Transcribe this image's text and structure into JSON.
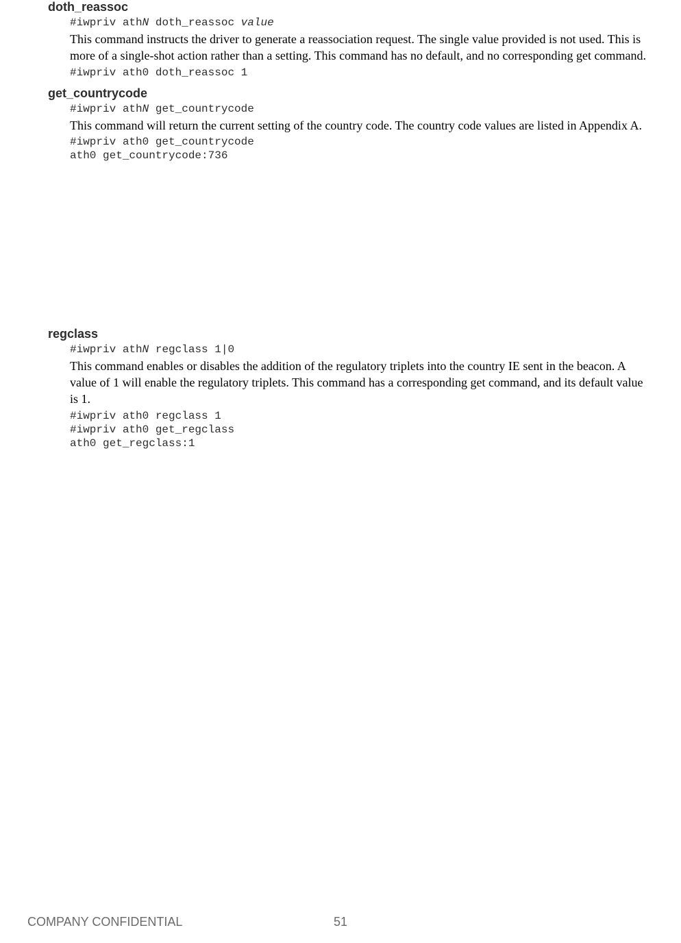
{
  "sections": [
    {
      "heading": "doth_reassoc",
      "syntax_prefix": "#iwpriv ath",
      "syntax_var1": "N",
      "syntax_mid": " doth_reassoc ",
      "syntax_var2": "value",
      "description": "This command instructs the driver to generate a reassociation request. The single value provided is not used. This is more of a single-shot action rather than a setting. This command has no default, and no corresponding get command.",
      "example": "#iwpriv ath0 doth_reassoc 1"
    },
    {
      "heading": "get_countrycode",
      "syntax_prefix": "#iwpriv ath",
      "syntax_var1": "N",
      "syntax_mid": " get_countrycode",
      "syntax_var2": "",
      "description": "This command will return the current setting of the country code. The country code values are listed in Appendix A.",
      "example": "#iwpriv ath0 get_countrycode\nath0 get_countrycode:736"
    },
    {
      "heading": "regclass",
      "syntax_prefix": "#iwpriv ath",
      "syntax_var1": "N",
      "syntax_mid": " regclass 1|0",
      "syntax_var2": "",
      "description": "This command enables or disables the addition of the regulatory triplets into the country IE sent in the beacon. A value of 1 will enable the regulatory triplets. This command has a corresponding get command, and its default value is 1.",
      "example": "#iwpriv ath0 regclass 1\n#iwpriv ath0 get_regclass\nath0 get_regclass:1"
    }
  ],
  "footer": {
    "left": "COMPANY CONFIDENTIAL",
    "page_number": "51"
  }
}
